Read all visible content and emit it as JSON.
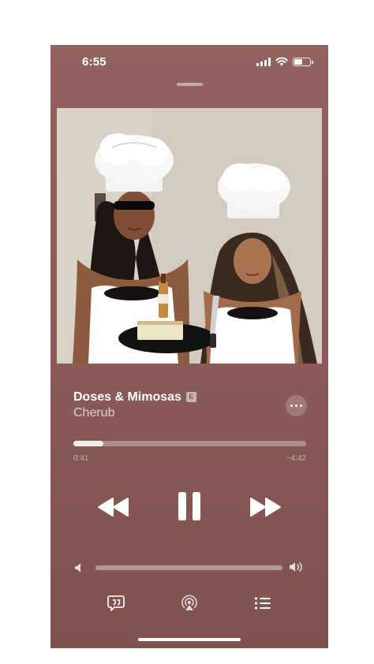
{
  "status_bar": {
    "time": "6:55",
    "battery_level": 0.55
  },
  "track": {
    "title": "Doses & Mimosas",
    "explicit_badge": "E",
    "artist": "Cherub"
  },
  "playback": {
    "progress_fraction": 0.13,
    "elapsed": "0:41",
    "remaining": "−4:42",
    "state": "playing"
  },
  "volume": {
    "level_fraction": 0.0
  },
  "icons": {
    "more": "ellipsis-icon",
    "rewind": "rewind-icon",
    "pause": "pause-icon",
    "forward": "fast-forward-icon",
    "volume_low": "speaker-low-icon",
    "volume_high": "speaker-high-icon",
    "lyrics": "lyrics-quote-icon",
    "airplay": "airplay-icon",
    "queue": "queue-list-icon"
  },
  "colors": {
    "background": "#8a5b57",
    "foreground": "#ffffff"
  }
}
